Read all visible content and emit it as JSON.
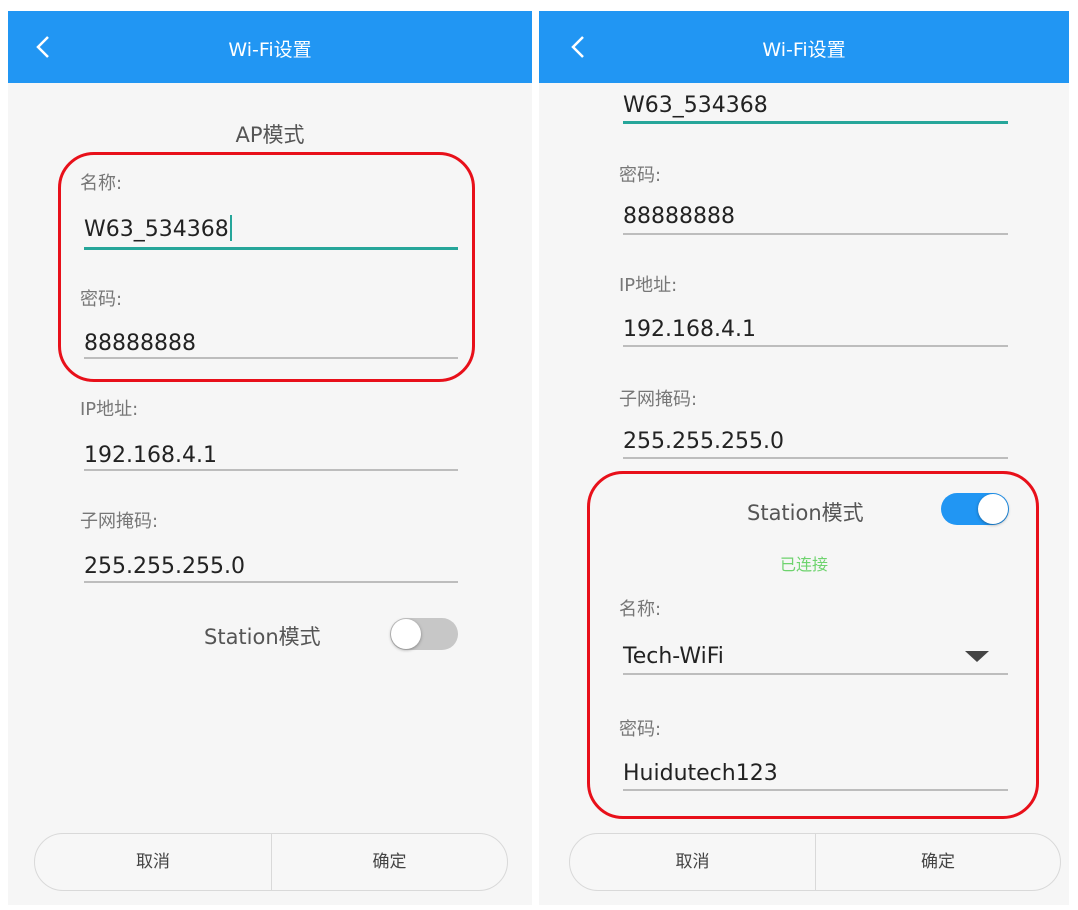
{
  "left": {
    "header_title": "Wi-Fi设置",
    "section_title": "AP模式",
    "name_label": "名称:",
    "name_value": "W63_534368",
    "password_label": "密码:",
    "password_value": "88888888",
    "ip_label": "IP地址:",
    "ip_value": "192.168.4.1",
    "subnet_label": "子网掩码:",
    "subnet_value": "255.255.255.0",
    "station_label": "Station模式",
    "station_enabled": false,
    "cancel": "取消",
    "confirm": "确定"
  },
  "right": {
    "header_title": "Wi-Fi设置",
    "name_value": "W63_534368",
    "password_label": "密码:",
    "password_value": "88888888",
    "ip_label": "IP地址:",
    "ip_value": "192.168.4.1",
    "subnet_label": "子网掩码:",
    "subnet_value": "255.255.255.0",
    "station_label": "Station模式",
    "station_enabled": true,
    "status": "已连接",
    "station_name_label": "名称:",
    "station_ssid": "Tech-WiFi",
    "station_password_label": "密码:",
    "station_password": "Huidutech123",
    "cancel": "取消",
    "confirm": "确定"
  },
  "colors": {
    "header": "#2196f3",
    "accent_underline": "#26a69a",
    "highlight_box": "#e8101a",
    "status_connected": "#6ed36e"
  }
}
